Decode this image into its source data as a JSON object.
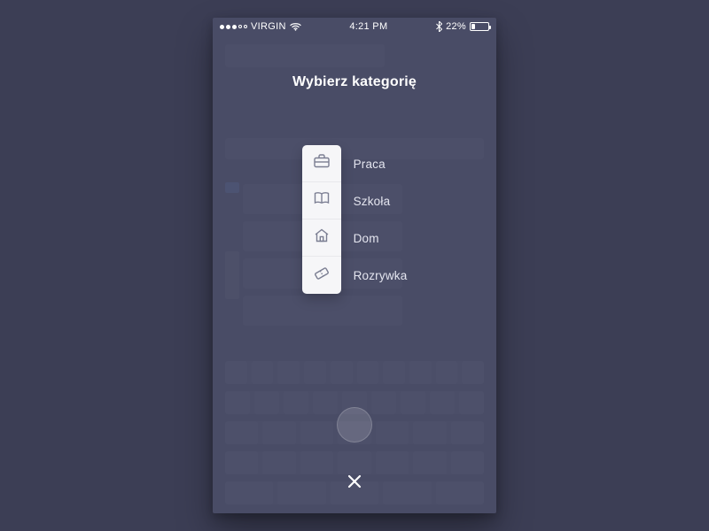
{
  "status_bar": {
    "carrier": "VIRGIN",
    "time": "4:21 PM",
    "battery_percent": "22%"
  },
  "overlay": {
    "title": "Wybierz kategorię"
  },
  "categories": [
    {
      "icon": "briefcase-icon",
      "label": "Praca"
    },
    {
      "icon": "book-icon",
      "label": "Szkoła"
    },
    {
      "icon": "home-icon",
      "label": "Dom"
    },
    {
      "icon": "ticket-icon",
      "label": "Rozrywka"
    }
  ]
}
